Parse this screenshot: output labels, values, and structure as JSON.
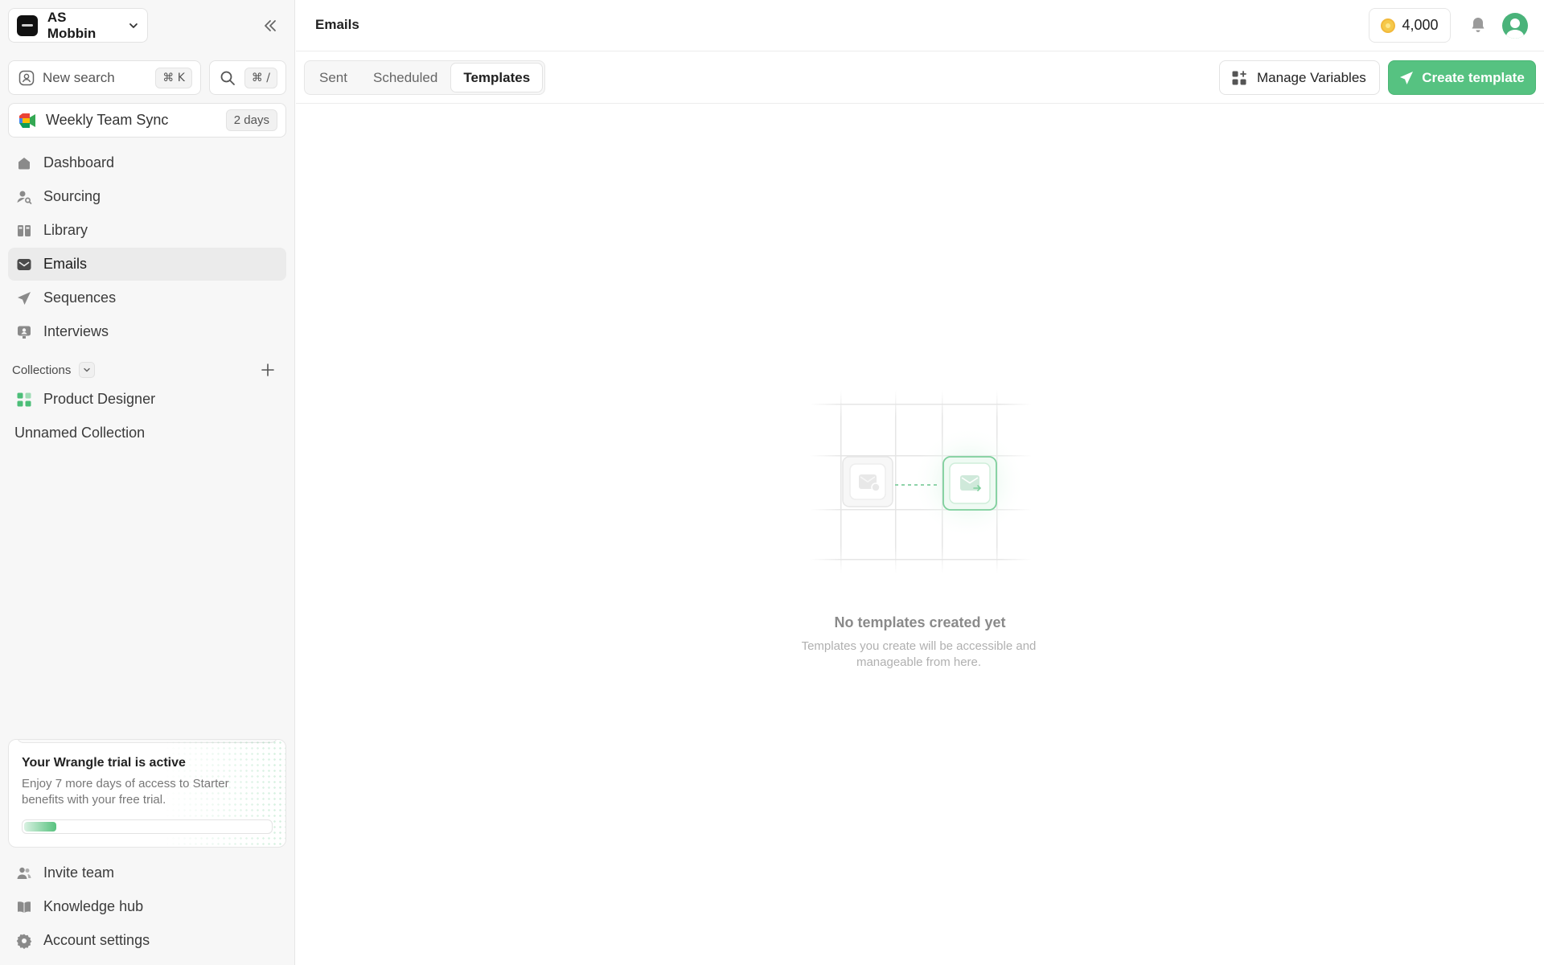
{
  "workspace": {
    "name": "AS Mobbin"
  },
  "sidebar": {
    "search": {
      "label": "New search",
      "shortcut": "⌘ K"
    },
    "command": {
      "shortcut": "⌘ /"
    },
    "meeting": {
      "title": "Weekly Team Sync",
      "badge": "2 days"
    },
    "nav": [
      {
        "label": "Dashboard",
        "icon": "home-icon"
      },
      {
        "label": "Sourcing",
        "icon": "person-search-icon"
      },
      {
        "label": "Library",
        "icon": "library-icon"
      },
      {
        "label": "Emails",
        "icon": "mail-icon",
        "active": true
      },
      {
        "label": "Sequences",
        "icon": "send-icon"
      },
      {
        "label": "Interviews",
        "icon": "interview-icon"
      }
    ],
    "collections": {
      "label": "Collections",
      "items": [
        {
          "label": "Product Designer",
          "icon": "grid-icon",
          "icon_color": "#4cbe78"
        },
        {
          "label": "Unnamed Collection"
        }
      ]
    },
    "trial": {
      "title": "Your Wrangle trial is active",
      "description": "Enjoy 7 more days of access to Starter benefits with your free trial.",
      "progress": 0.13
    },
    "bottom_nav": [
      {
        "label": "Invite team",
        "icon": "users-icon"
      },
      {
        "label": "Knowledge hub",
        "icon": "book-icon"
      },
      {
        "label": "Account settings",
        "icon": "gear-icon"
      }
    ]
  },
  "header": {
    "title": "Emails",
    "credits": "4,000"
  },
  "toolbar": {
    "tabs": [
      {
        "label": "Sent"
      },
      {
        "label": "Scheduled"
      },
      {
        "label": "Templates",
        "active": true
      }
    ],
    "manage_label": "Manage Variables",
    "create_label": "Create template"
  },
  "empty_state": {
    "title": "No templates created yet",
    "description": "Templates you create will be accessible and manageable from here."
  },
  "colors": {
    "accent": "#56c281",
    "active_nav_bg": "#ebebeb",
    "sidebar_bg": "#f7f7f7",
    "coin": "#f5c94a"
  }
}
